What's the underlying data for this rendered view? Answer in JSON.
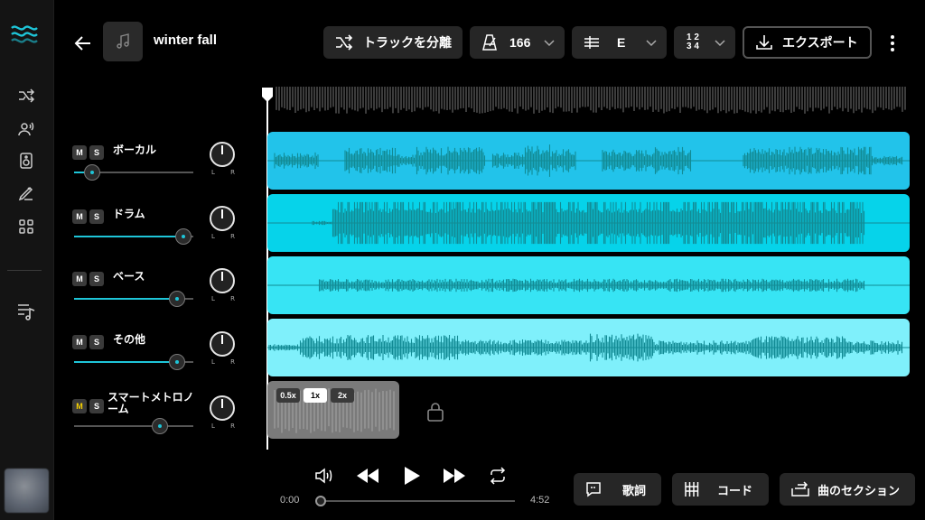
{
  "header": {
    "song_title": "winter fall",
    "separate_label": "トラックを分離",
    "tempo": "166",
    "key": "E",
    "time_sig_top": "1 2",
    "time_sig_bottom": "3 4",
    "export_label": "エクスポート"
  },
  "tracks": [
    {
      "name": "ボーカル",
      "mute": "M",
      "solo": "S",
      "level": 0.15,
      "color": "#22c3ea"
    },
    {
      "name": "ドラム",
      "mute": "M",
      "solo": "S",
      "level": 0.92,
      "color": "#06d3ea"
    },
    {
      "name": "ベース",
      "mute": "M",
      "solo": "S",
      "level": 0.86,
      "color": "#37e4f4"
    },
    {
      "name": "その他",
      "mute": "M",
      "solo": "S",
      "level": 0.86,
      "color": "#7ff0fb"
    }
  ],
  "metronome": {
    "name": "スマートメトロノーム",
    "mute": "M",
    "solo": "S",
    "level": 0.72,
    "speeds": [
      "0.5x",
      "1x",
      "2x"
    ],
    "selected_speed": "1x"
  },
  "pan_labels": {
    "left": "L",
    "right": "R"
  },
  "transport": {
    "current_time": "0:00",
    "total_time": "4:52",
    "progress": 0.0
  },
  "footer_buttons": {
    "lyrics": "歌詞",
    "chords": "コード",
    "sections": "曲のセクション"
  },
  "colors": {
    "accent": "#1ec5d8",
    "waveform": "#128b95",
    "metronome_mute_active": "#f5d000"
  }
}
